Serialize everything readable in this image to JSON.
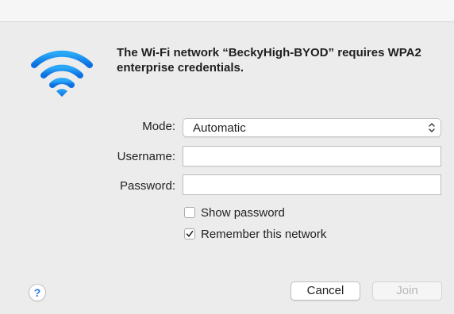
{
  "dialog": {
    "message": "The Wi-Fi network “BeckyHigh-BYOD” requires WPA2 enterprise credentials.",
    "icon": "wifi-icon",
    "accent_color": "#1a8cf0"
  },
  "form": {
    "mode": {
      "label": "Mode:",
      "value": "Automatic"
    },
    "username": {
      "label": "Username:",
      "value": ""
    },
    "password": {
      "label": "Password:",
      "value": ""
    },
    "show_password": {
      "label": "Show password",
      "checked": false
    },
    "remember_network": {
      "label": "Remember this network",
      "checked": true
    }
  },
  "buttons": {
    "help": "?",
    "cancel": "Cancel",
    "join": "Join",
    "join_enabled": false
  }
}
